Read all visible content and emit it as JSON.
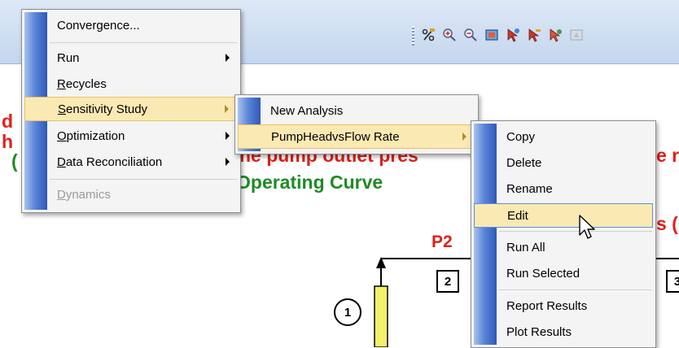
{
  "toolbar": {
    "buttons": [
      {
        "name": "percent-tool-icon"
      },
      {
        "name": "zoom-in-icon"
      },
      {
        "name": "zoom-out-icon"
      },
      {
        "name": "zoom-window-icon"
      },
      {
        "name": "pointer-add-icon"
      },
      {
        "name": "pointer-remove-icon"
      },
      {
        "name": "pointer-info-icon"
      },
      {
        "name": "disabled-tool-icon"
      }
    ]
  },
  "canvas": {
    "red_text_line": "he pump outlet pres",
    "red_text_right": "e r",
    "green_text": "Operating Curve",
    "red_text_right2": "s (",
    "stream_label": "P2",
    "stream_box_2": "2",
    "stream_box_3": "3",
    "unit_circle": "1",
    "left_fragment_1": "d",
    "left_fragment_2": "h",
    "left_fragment_3": "("
  },
  "main_menu": {
    "items": [
      {
        "label": "Convergence...",
        "mnemonic_prefix": "",
        "mnemonic": "",
        "rest": "Convergence..."
      },
      {
        "label": "Run",
        "mnemonic_prefix": "",
        "mnemonic": "",
        "rest": "Run"
      },
      {
        "label": "Recycles",
        "mnemonic_prefix": "",
        "mnemonic": "R",
        "rest": "ecycles"
      },
      {
        "label": "Sensitivity Study",
        "mnemonic_prefix": "",
        "mnemonic": "S",
        "rest": "ensitivity Study"
      },
      {
        "label": "Optimization",
        "mnemonic_prefix": "",
        "mnemonic": "O",
        "rest": "ptimization"
      },
      {
        "label": "Data Reconciliation",
        "mnemonic_prefix": "",
        "mnemonic": "D",
        "rest": "ata Reconciliation"
      },
      {
        "label": "Dynamics",
        "mnemonic_prefix": "",
        "mnemonic": "D",
        "rest": "ynamics"
      }
    ]
  },
  "sensitivity_menu": {
    "items": [
      {
        "label": "New Analysis"
      },
      {
        "label": "PumpHeadvsFlow Rate"
      }
    ]
  },
  "analysis_menu": {
    "items": [
      {
        "label": "Copy"
      },
      {
        "label": "Delete"
      },
      {
        "label": "Rename"
      },
      {
        "label": "Edit"
      },
      {
        "label": "Run All"
      },
      {
        "label": "Run Selected"
      },
      {
        "label": "Report Results"
      },
      {
        "label": "Plot Results"
      }
    ]
  }
}
